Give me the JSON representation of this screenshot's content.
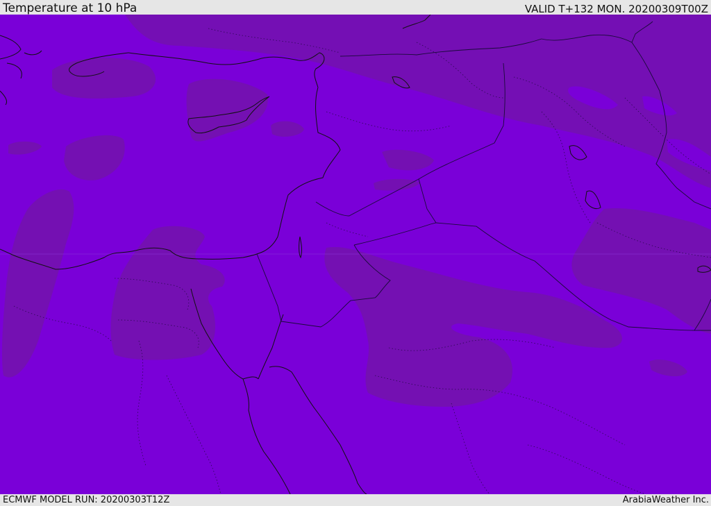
{
  "header": {
    "title": "Temperature at 10 hPa",
    "valid": "VALID T+132 MON. 20200309T00Z"
  },
  "footer": {
    "model_run": "ECMWF MODEL RUN: 20200303T12Z",
    "credit": "ArabiaWeather Inc."
  },
  "map": {
    "colors": {
      "fill_main": "#7a00d8",
      "fill_warm": "#7410b2",
      "coast": "#111111",
      "border": "#1a0a3a"
    }
  }
}
